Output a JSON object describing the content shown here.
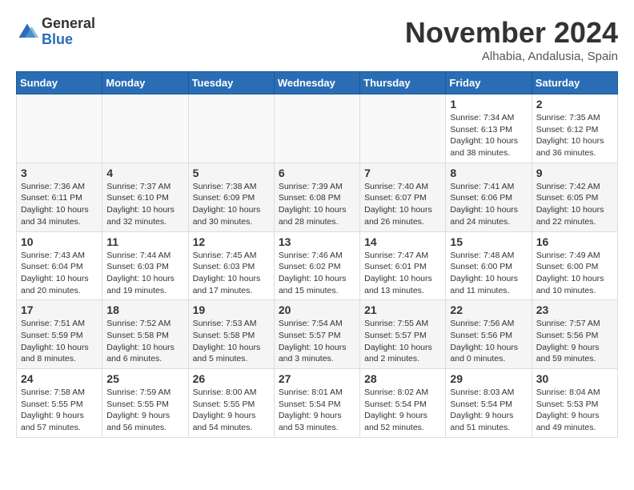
{
  "logo": {
    "general": "General",
    "blue": "Blue"
  },
  "title": "November 2024",
  "location": "Alhabia, Andalusia, Spain",
  "headers": [
    "Sunday",
    "Monday",
    "Tuesday",
    "Wednesday",
    "Thursday",
    "Friday",
    "Saturday"
  ],
  "weeks": [
    [
      {
        "day": "",
        "info": ""
      },
      {
        "day": "",
        "info": ""
      },
      {
        "day": "",
        "info": ""
      },
      {
        "day": "",
        "info": ""
      },
      {
        "day": "",
        "info": ""
      },
      {
        "day": "1",
        "info": "Sunrise: 7:34 AM\nSunset: 6:13 PM\nDaylight: 10 hours\nand 38 minutes."
      },
      {
        "day": "2",
        "info": "Sunrise: 7:35 AM\nSunset: 6:12 PM\nDaylight: 10 hours\nand 36 minutes."
      }
    ],
    [
      {
        "day": "3",
        "info": "Sunrise: 7:36 AM\nSunset: 6:11 PM\nDaylight: 10 hours\nand 34 minutes."
      },
      {
        "day": "4",
        "info": "Sunrise: 7:37 AM\nSunset: 6:10 PM\nDaylight: 10 hours\nand 32 minutes."
      },
      {
        "day": "5",
        "info": "Sunrise: 7:38 AM\nSunset: 6:09 PM\nDaylight: 10 hours\nand 30 minutes."
      },
      {
        "day": "6",
        "info": "Sunrise: 7:39 AM\nSunset: 6:08 PM\nDaylight: 10 hours\nand 28 minutes."
      },
      {
        "day": "7",
        "info": "Sunrise: 7:40 AM\nSunset: 6:07 PM\nDaylight: 10 hours\nand 26 minutes."
      },
      {
        "day": "8",
        "info": "Sunrise: 7:41 AM\nSunset: 6:06 PM\nDaylight: 10 hours\nand 24 minutes."
      },
      {
        "day": "9",
        "info": "Sunrise: 7:42 AM\nSunset: 6:05 PM\nDaylight: 10 hours\nand 22 minutes."
      }
    ],
    [
      {
        "day": "10",
        "info": "Sunrise: 7:43 AM\nSunset: 6:04 PM\nDaylight: 10 hours\nand 20 minutes."
      },
      {
        "day": "11",
        "info": "Sunrise: 7:44 AM\nSunset: 6:03 PM\nDaylight: 10 hours\nand 19 minutes."
      },
      {
        "day": "12",
        "info": "Sunrise: 7:45 AM\nSunset: 6:03 PM\nDaylight: 10 hours\nand 17 minutes."
      },
      {
        "day": "13",
        "info": "Sunrise: 7:46 AM\nSunset: 6:02 PM\nDaylight: 10 hours\nand 15 minutes."
      },
      {
        "day": "14",
        "info": "Sunrise: 7:47 AM\nSunset: 6:01 PM\nDaylight: 10 hours\nand 13 minutes."
      },
      {
        "day": "15",
        "info": "Sunrise: 7:48 AM\nSunset: 6:00 PM\nDaylight: 10 hours\nand 11 minutes."
      },
      {
        "day": "16",
        "info": "Sunrise: 7:49 AM\nSunset: 6:00 PM\nDaylight: 10 hours\nand 10 minutes."
      }
    ],
    [
      {
        "day": "17",
        "info": "Sunrise: 7:51 AM\nSunset: 5:59 PM\nDaylight: 10 hours\nand 8 minutes."
      },
      {
        "day": "18",
        "info": "Sunrise: 7:52 AM\nSunset: 5:58 PM\nDaylight: 10 hours\nand 6 minutes."
      },
      {
        "day": "19",
        "info": "Sunrise: 7:53 AM\nSunset: 5:58 PM\nDaylight: 10 hours\nand 5 minutes."
      },
      {
        "day": "20",
        "info": "Sunrise: 7:54 AM\nSunset: 5:57 PM\nDaylight: 10 hours\nand 3 minutes."
      },
      {
        "day": "21",
        "info": "Sunrise: 7:55 AM\nSunset: 5:57 PM\nDaylight: 10 hours\nand 2 minutes."
      },
      {
        "day": "22",
        "info": "Sunrise: 7:56 AM\nSunset: 5:56 PM\nDaylight: 10 hours\nand 0 minutes."
      },
      {
        "day": "23",
        "info": "Sunrise: 7:57 AM\nSunset: 5:56 PM\nDaylight: 9 hours\nand 59 minutes."
      }
    ],
    [
      {
        "day": "24",
        "info": "Sunrise: 7:58 AM\nSunset: 5:55 PM\nDaylight: 9 hours\nand 57 minutes."
      },
      {
        "day": "25",
        "info": "Sunrise: 7:59 AM\nSunset: 5:55 PM\nDaylight: 9 hours\nand 56 minutes."
      },
      {
        "day": "26",
        "info": "Sunrise: 8:00 AM\nSunset: 5:55 PM\nDaylight: 9 hours\nand 54 minutes."
      },
      {
        "day": "27",
        "info": "Sunrise: 8:01 AM\nSunset: 5:54 PM\nDaylight: 9 hours\nand 53 minutes."
      },
      {
        "day": "28",
        "info": "Sunrise: 8:02 AM\nSunset: 5:54 PM\nDaylight: 9 hours\nand 52 minutes."
      },
      {
        "day": "29",
        "info": "Sunrise: 8:03 AM\nSunset: 5:54 PM\nDaylight: 9 hours\nand 51 minutes."
      },
      {
        "day": "30",
        "info": "Sunrise: 8:04 AM\nSunset: 5:53 PM\nDaylight: 9 hours\nand 49 minutes."
      }
    ]
  ]
}
